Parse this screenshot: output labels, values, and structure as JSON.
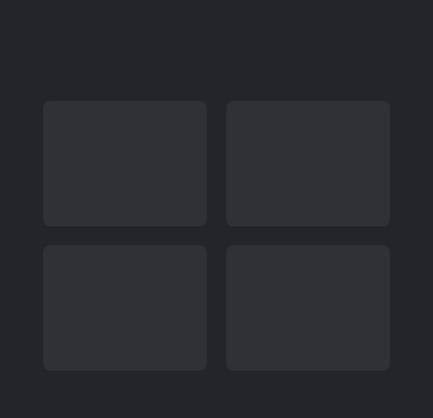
{
  "theme": {
    "background": "#232529",
    "tile": "#2f3135"
  },
  "tiles": [
    {
      "label": ""
    },
    {
      "label": ""
    },
    {
      "label": ""
    },
    {
      "label": ""
    }
  ]
}
